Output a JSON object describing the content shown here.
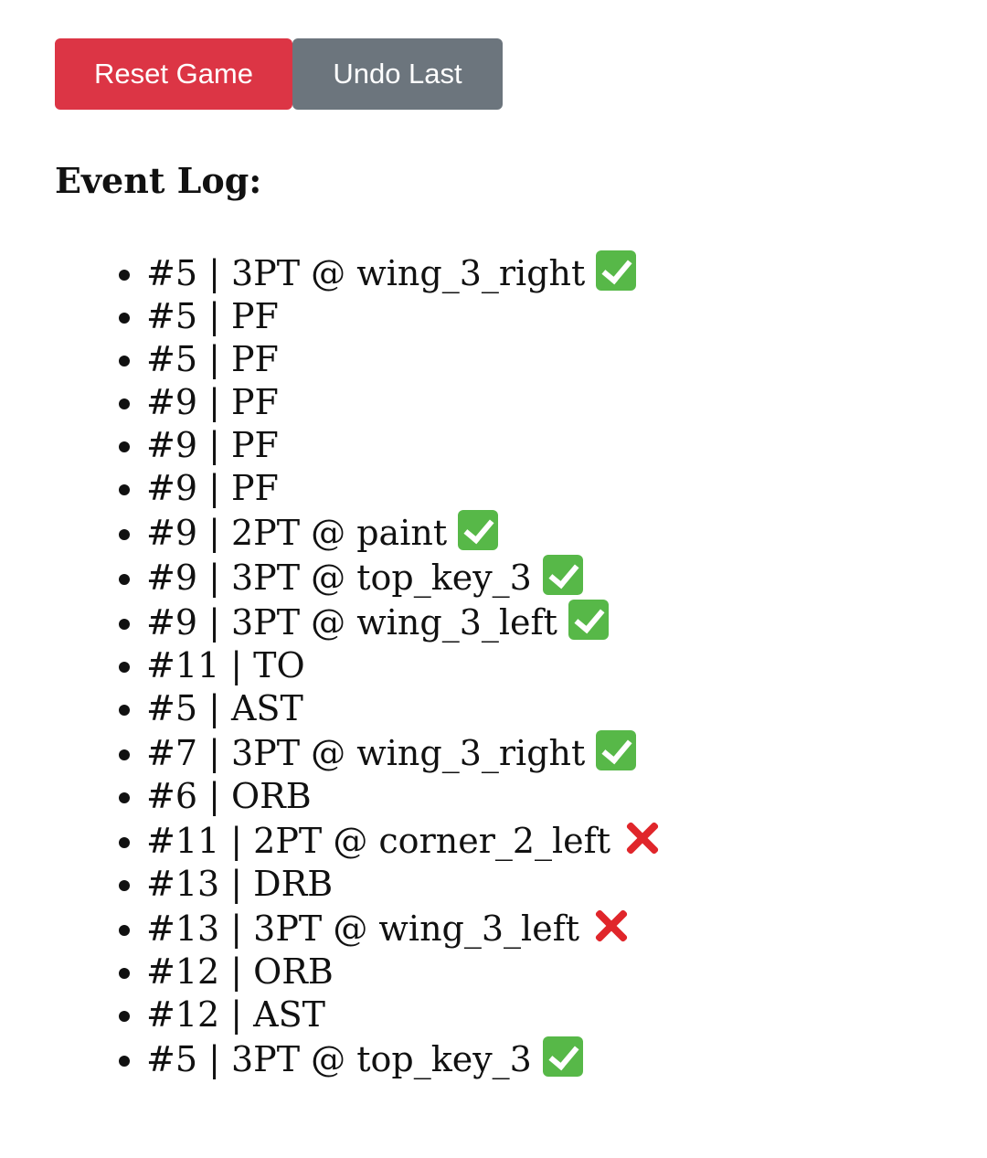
{
  "toolbar": {
    "reset_label": "Reset Game",
    "undo_label": "Undo Last"
  },
  "log": {
    "title": "Event Log:",
    "entries": [
      {
        "text": "#5 | 3PT @ wing_3_right",
        "result": "made"
      },
      {
        "text": "#5 | PF",
        "result": ""
      },
      {
        "text": "#5 | PF",
        "result": ""
      },
      {
        "text": "#9 | PF",
        "result": ""
      },
      {
        "text": "#9 | PF",
        "result": ""
      },
      {
        "text": "#9 | PF",
        "result": ""
      },
      {
        "text": "#9 | 2PT @ paint",
        "result": "made"
      },
      {
        "text": "#9 | 3PT @ top_key_3",
        "result": "made"
      },
      {
        "text": "#9 | 3PT @ wing_3_left",
        "result": "made"
      },
      {
        "text": "#11 | TO",
        "result": ""
      },
      {
        "text": "#5 | AST",
        "result": ""
      },
      {
        "text": "#7 | 3PT @ wing_3_right",
        "result": "made"
      },
      {
        "text": "#6 | ORB",
        "result": ""
      },
      {
        "text": "#11 | 2PT @ corner_2_left",
        "result": "missed"
      },
      {
        "text": "#13 | DRB",
        "result": ""
      },
      {
        "text": "#13 | 3PT @ wing_3_left",
        "result": "missed"
      },
      {
        "text": "#12 | ORB",
        "result": ""
      },
      {
        "text": "#12 | AST",
        "result": ""
      },
      {
        "text": "#5 | 3PT @ top_key_3",
        "result": "made"
      }
    ]
  },
  "icons": {
    "made": "check-mark-icon",
    "missed": "cross-mark-icon"
  },
  "colors": {
    "reset_button": "#dc3545",
    "undo_button": "#6c757d",
    "made_mark": "#57b848",
    "missed_mark": "#e0262b"
  }
}
